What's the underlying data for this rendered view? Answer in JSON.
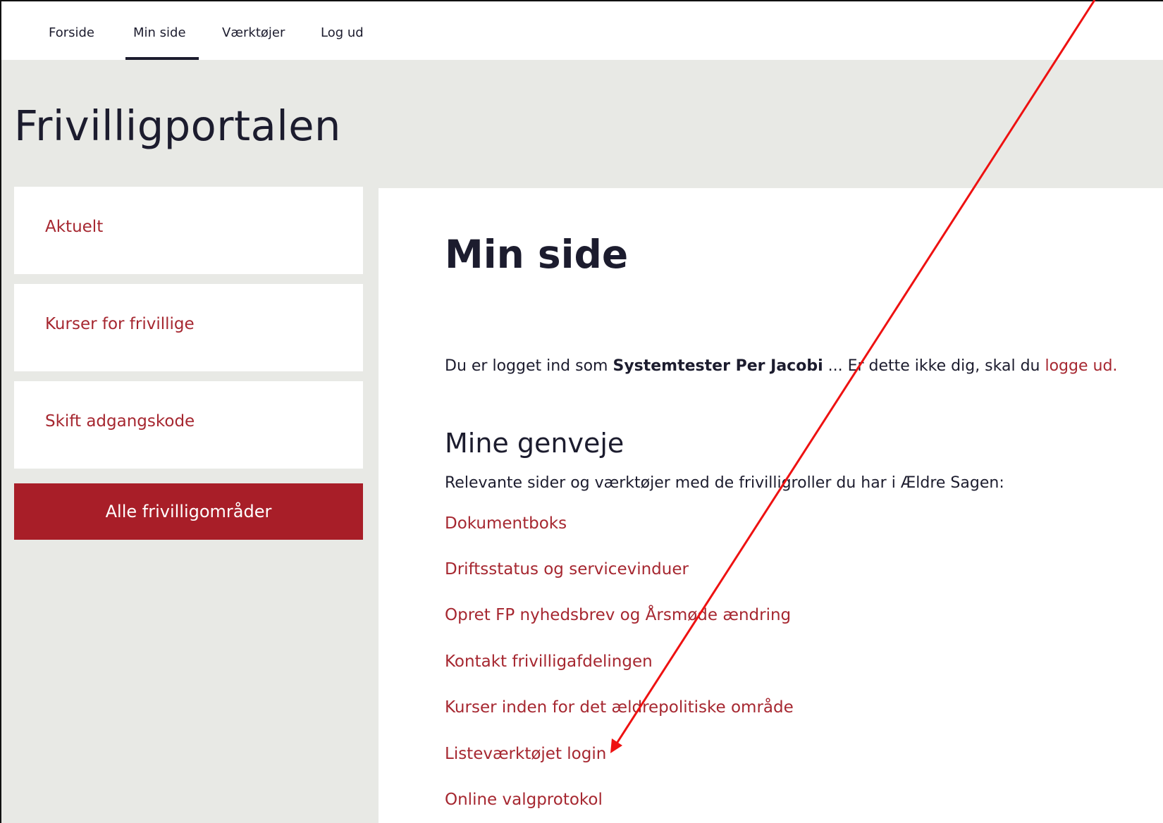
{
  "topnav": {
    "items": [
      {
        "label": "Forside"
      },
      {
        "label": "Min side"
      },
      {
        "label": "Værktøjer"
      },
      {
        "label": "Log ud"
      }
    ],
    "active": "Min side"
  },
  "site_title": "Frivilligportalen",
  "sidebar": {
    "items": [
      {
        "label": "Aktuelt"
      },
      {
        "label": "Kurser for frivillige"
      },
      {
        "label": "Skift adgangskode"
      }
    ],
    "button_label": "Alle frivilligområder"
  },
  "main": {
    "title": "Min side",
    "login_prefix": "Du er logget ind som ",
    "login_user": "Systemtester Per Jacobi",
    "login_middle": " ... Er dette ikke dig, skal du ",
    "login_link": "logge ud.",
    "shortcuts_heading": "Mine genveje",
    "shortcuts_intro": "Relevante sider og værktøjer med de frivilligroller du har i Ældre Sagen:",
    "links": [
      {
        "label": "Dokumentboks"
      },
      {
        "label": "Driftsstatus og servicevinduer"
      },
      {
        "label": "Opret FP nyhedsbrev og Årsmøde ændring"
      },
      {
        "label": "Kontakt frivilligafdelingen"
      },
      {
        "label": "Kurser inden for det ældrepolitiske område"
      },
      {
        "label": "Listeværktøjet login"
      },
      {
        "label": "Online valgprotokol"
      }
    ]
  },
  "colors": {
    "accent_red": "#a81e28",
    "link_red": "#a62730",
    "navy_text": "#1c1c2e",
    "band_bg": "#e8e9e5",
    "annotation_arrow": "#ee1111"
  }
}
